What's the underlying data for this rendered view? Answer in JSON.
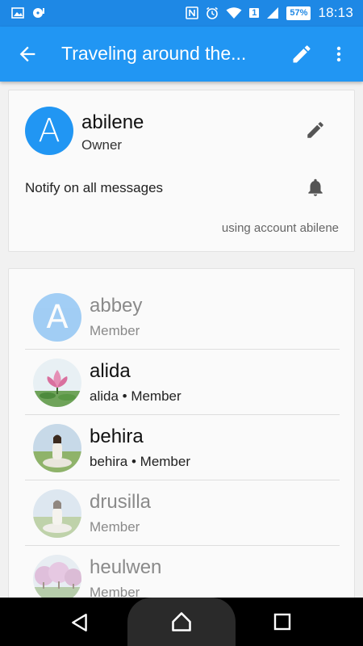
{
  "status_bar": {
    "time": "18:13",
    "battery_percent": "57%",
    "sim_indicator": "1",
    "icons": [
      "image-icon",
      "media-icon",
      "nfc-icon",
      "alarm-icon",
      "wifi-icon",
      "signal-icon",
      "battery-icon"
    ]
  },
  "app_bar": {
    "title": "Traveling around the...",
    "back_icon": "arrow-back-icon",
    "edit_icon": "pencil-icon",
    "more_icon": "more-vert-icon",
    "color": "#2196f3"
  },
  "owner_card": {
    "avatar_letter": "A",
    "avatar_color": "#2196f3",
    "name": "abilene",
    "role": "Owner",
    "notify_label": "Notify on all messages",
    "account_note": "using account abilene"
  },
  "members": [
    {
      "name": "abbey",
      "role": "Member",
      "online": false,
      "avatar": "letter",
      "avatar_letter": "A",
      "avatar_color": "#5aa9f0"
    },
    {
      "name": "alida",
      "role": "alida • Member",
      "online": true,
      "avatar": "lotus-photo"
    },
    {
      "name": "behira",
      "role": "behira • Member",
      "online": true,
      "avatar": "meditation-photo"
    },
    {
      "name": "drusilla",
      "role": "Member",
      "online": false,
      "avatar": "meditation-photo"
    },
    {
      "name": "heulwen",
      "role": "Member",
      "online": false,
      "avatar": "blossom-photo"
    }
  ]
}
